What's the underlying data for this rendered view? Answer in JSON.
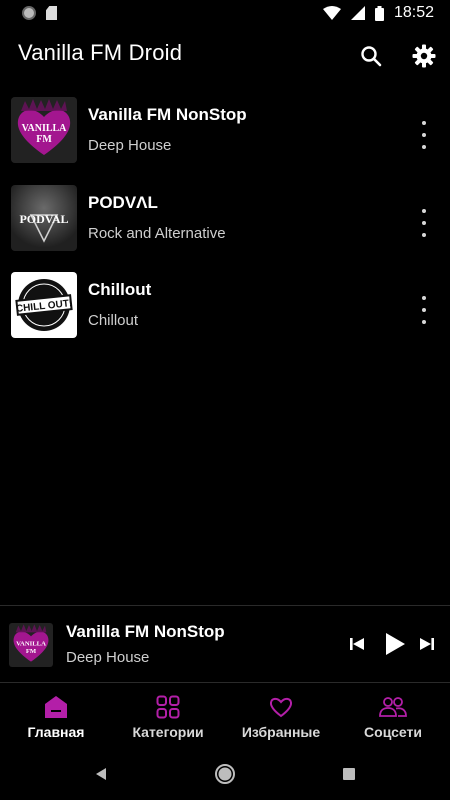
{
  "status": {
    "time": "18:52"
  },
  "app": {
    "title": "Vanilla FM Droid"
  },
  "stations": [
    {
      "name": "Vanilla FM NonStop",
      "genre": "Deep House",
      "logo_text": "VANILLA FM"
    },
    {
      "name": "PODVΛL",
      "genre": "Rock and Alternative",
      "logo_text": "PODVAL"
    },
    {
      "name": "Chillout",
      "genre": "Chillout",
      "logo_text": "CHILL OUT!"
    }
  ],
  "player": {
    "name": "Vanilla FM NonStop",
    "genre": "Deep House"
  },
  "nav": {
    "home": "Главная",
    "categories": "Категории",
    "favorites": "Избранные",
    "social": "Соцсети"
  },
  "colors": {
    "accent": "#b31fa8",
    "background": "#000000"
  },
  "icons": {
    "search": "search-icon",
    "settings": "gear-icon",
    "more": "more-vert-icon",
    "prev": "skip-previous-icon",
    "play": "play-icon",
    "next": "skip-next-icon",
    "home": "home-icon",
    "categories": "grid-icon",
    "favorites": "heart-icon",
    "social": "people-icon"
  }
}
